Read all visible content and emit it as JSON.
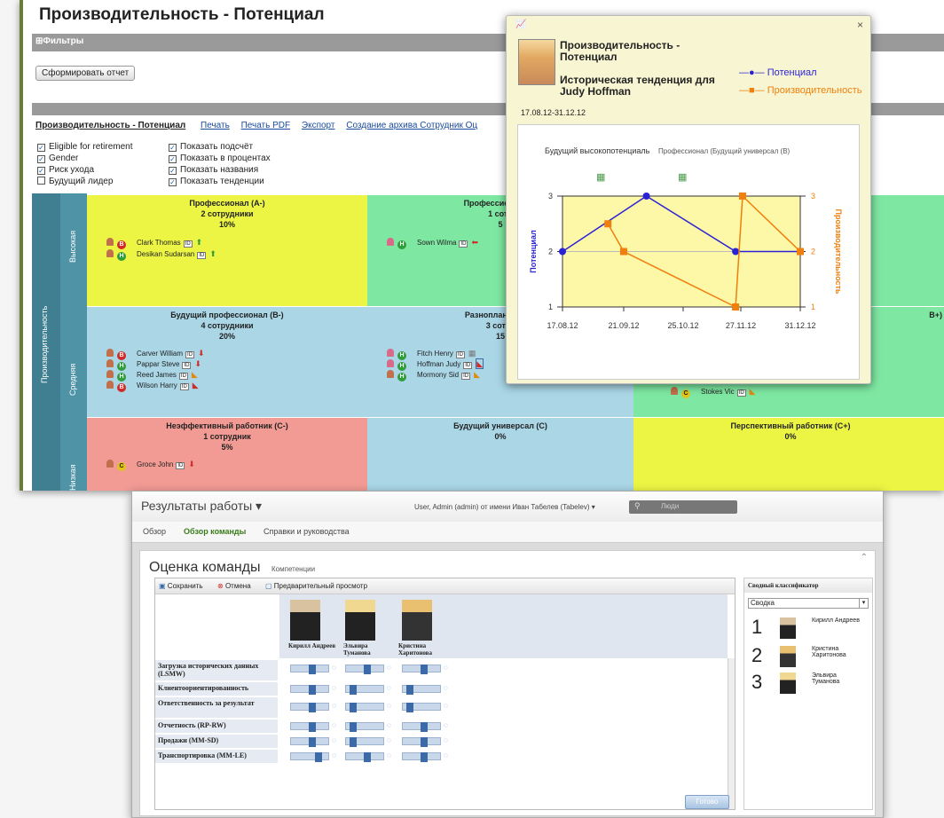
{
  "top": {
    "title": "Производительность - Потенциал",
    "filters": "⊞Фильтры",
    "generate_btn": "Сформировать отчет",
    "links": {
      "report": "Производительность - Потенциал",
      "print": "Печать",
      "print_pdf": "Печать PDF",
      "export": "Экспорт",
      "archive": "Создание архива Сотрудник Оц"
    },
    "checks_left": [
      {
        "label": "Eligible for retirement",
        "checked": true
      },
      {
        "label": "Gender",
        "checked": true
      },
      {
        "label": "Риск ухода",
        "checked": true
      },
      {
        "label": "Будущий лидер",
        "checked": false
      }
    ],
    "checks_right": [
      {
        "label": "Показать подсчёт",
        "checked": true
      },
      {
        "label": "Показать в процентах",
        "checked": true
      },
      {
        "label": "Показать названия",
        "checked": true
      },
      {
        "label": "Показать тенденции",
        "checked": true
      }
    ],
    "axis_main": "Производительность",
    "axis_rows": [
      "Высокая",
      "Средняя",
      "Низкая"
    ],
    "cells": {
      "a": {
        "title": "Профессионал (A-)",
        "count": "2 сотрудники",
        "pct": "10%"
      },
      "b": {
        "title": "Профессионал ши",
        "count": "1 сотр",
        "pct": "5"
      },
      "c": {
        "title": "Будущий профессионал (B-)",
        "count": "4 сотрудники",
        "pct": "20%"
      },
      "d": {
        "title": "Разноплановый и",
        "count": "3 сотру",
        "pct": "15"
      },
      "e": {
        "title": "B+)"
      },
      "f": {
        "title": "Неэффективный работник (C-)",
        "count": "1 сотрудник",
        "pct": "5%"
      },
      "g": {
        "title": "Будущий универсал (C)",
        "pct": "0%"
      },
      "h": {
        "title": "Перспективный работник (C+)",
        "pct": "0%"
      }
    },
    "employees": {
      "a": [
        "Clark Thomas",
        "Desikan Sudarsan"
      ],
      "b": [
        "Sown Wilma"
      ],
      "c": [
        "Carver William",
        "Pappar Steve",
        "Reed James",
        "Wilson Harry"
      ],
      "d": [
        "Fitch Henry",
        "Hoffman Judy",
        "Mormony Sid"
      ],
      "e": [
        "Stokes Vic"
      ],
      "f": [
        "Groce John"
      ]
    },
    "badges": {
      "red": "B",
      "grn": "H",
      "yel": "C"
    }
  },
  "popup": {
    "close": "×",
    "title": "Производительность - Потенциал",
    "subtitle": "Историческая тенденция для Judy Hoffman",
    "daterange": "17.08.12-31.12.12",
    "legend": [
      "Потенциал",
      "Производительность"
    ],
    "chart_header": "Будущий высокопотенциаль",
    "chart_header_overlap": "Профессионал (Будущий универсал (В)"
  },
  "chart_data": {
    "type": "line",
    "x": [
      "17.08.12",
      "21.09.12",
      "25.10.12",
      "27.11.12",
      "31.12.12"
    ],
    "ylabel": "Потенциал",
    "y2label": "Производительность",
    "ylim": [
      1,
      3
    ],
    "colors": {
      "potential": "#2b22d6",
      "performance": "#f07f0c"
    },
    "series": [
      {
        "name": "Потенциал",
        "points": [
          [
            "17.08.12",
            2
          ],
          [
            "04.10.12",
            3
          ],
          [
            "24.11.12",
            2
          ],
          [
            "31.12.12",
            2
          ]
        ]
      },
      {
        "name": "Производительность",
        "points": [
          [
            "17.08.12",
            null
          ],
          [
            "12.09.12",
            2.5
          ],
          [
            "21.09.12",
            2
          ],
          [
            "24.11.12",
            1
          ],
          [
            "28.11.12",
            3
          ],
          [
            "31.12.12",
            2
          ]
        ]
      }
    ]
  },
  "bottom": {
    "app_title": "Результаты работы ▾",
    "user_info": "User, Admin (admin) от имени Иван Табелев (Tabelev) ▾",
    "search_placeholder": "Люди",
    "nav": [
      "Обзор",
      "Обзор команды",
      "Справки и руководства"
    ],
    "heading": "Оценка команды",
    "heading_sub": "Компетенции",
    "toolbar": [
      "Сохранить",
      "Отмена",
      "Предварительный просмотр"
    ],
    "people": [
      "Кирилл Андреев",
      "Эльвира Туманова",
      "Кристина Харитонова"
    ],
    "rows": [
      "Загрузка исторических данных (LSMW)",
      "Клиентоориентированность",
      "Ответственность за результат",
      "Отчетность (RP-RW)",
      "Продажи (MM-SD)",
      "Транспортировка (MM-LE)"
    ],
    "side_title": "Сводный классификатор",
    "side_select": "Сводка",
    "ranking": [
      {
        "rank": "1",
        "name": "Кирилл Андреев"
      },
      {
        "rank": "2",
        "name": "Кристина Харитонова"
      },
      {
        "rank": "3",
        "name": "Эльвира Туманова"
      }
    ],
    "done": "Готово"
  }
}
